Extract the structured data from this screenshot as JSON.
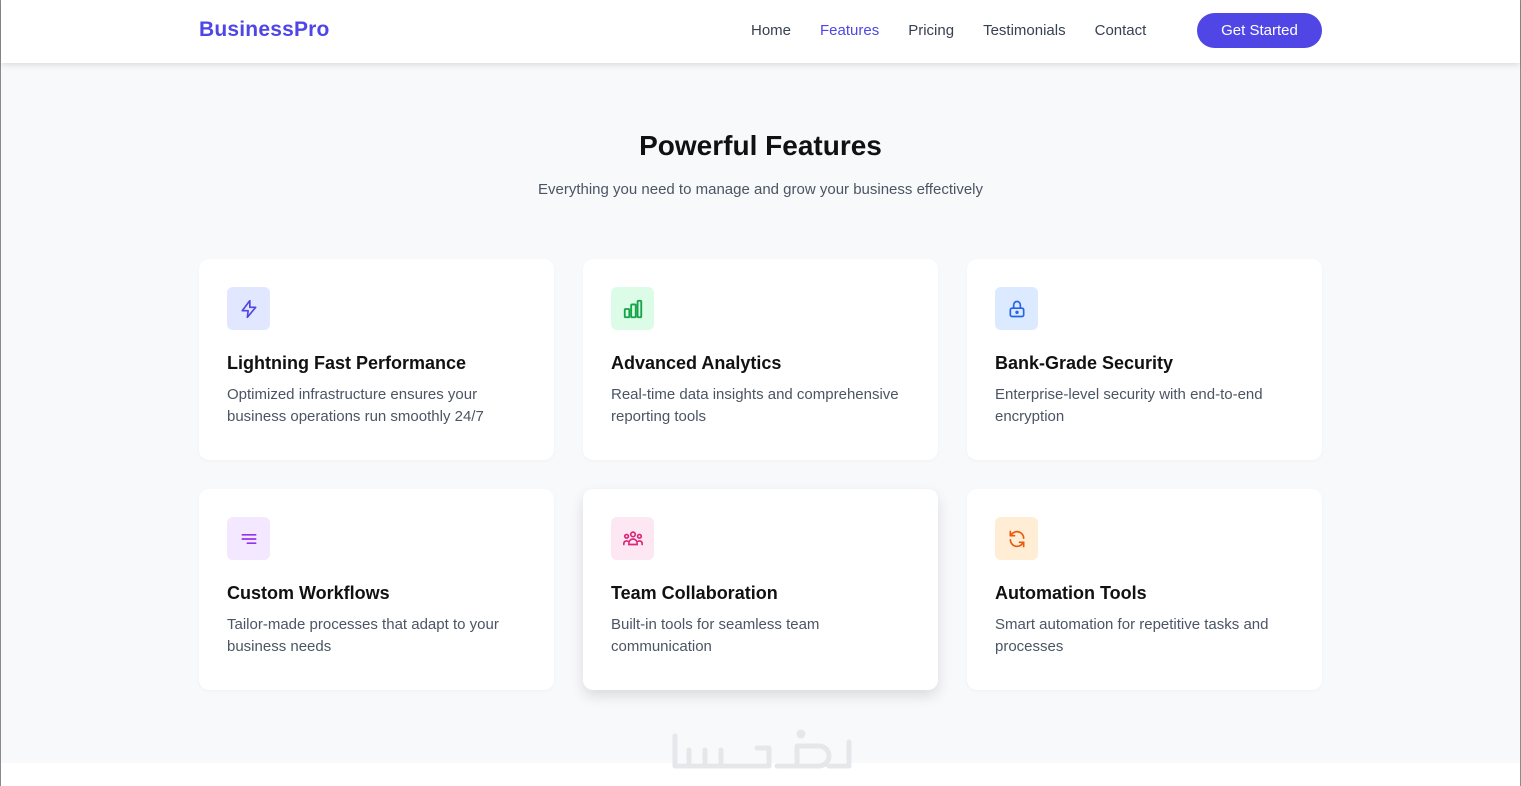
{
  "nav": {
    "brand": "BusinessPro",
    "links": [
      "Home",
      "Features",
      "Pricing",
      "Testimonials",
      "Contact"
    ],
    "active": "Features",
    "cta": "Get Started"
  },
  "section": {
    "title": "Powerful Features",
    "subtitle": "Everything you need to manage and grow your business effectively"
  },
  "features": [
    {
      "icon": "lightning-icon",
      "title": "Lightning Fast Performance",
      "desc": "Optimized infrastructure ensures your business operations run smoothly 24/7",
      "bg": "#e0e7ff",
      "fg": "#4f46e5"
    },
    {
      "icon": "bar-chart-icon",
      "title": "Advanced Analytics",
      "desc": "Real-time data insights and comprehensive reporting tools",
      "bg": "#dcfce7",
      "fg": "#16a34a"
    },
    {
      "icon": "lock-icon",
      "title": "Bank-Grade Security",
      "desc": "Enterprise-level security with end-to-end encryption",
      "bg": "#dbeafe",
      "fg": "#2563eb"
    },
    {
      "icon": "menu-lines-icon",
      "title": "Custom Workflows",
      "desc": "Tailor-made processes that adapt to your business needs",
      "bg": "#f3e8ff",
      "fg": "#9333ea"
    },
    {
      "icon": "team-icon",
      "title": "Team Collaboration",
      "desc": "Built-in tools for seamless team communication",
      "bg": "#fce7f3",
      "fg": "#db2777"
    },
    {
      "icon": "refresh-icon",
      "title": "Automation Tools",
      "desc": "Smart automation for repetitive tasks and processes",
      "bg": "#ffedd5",
      "fg": "#ea580c"
    }
  ],
  "watermark": "خمسات"
}
